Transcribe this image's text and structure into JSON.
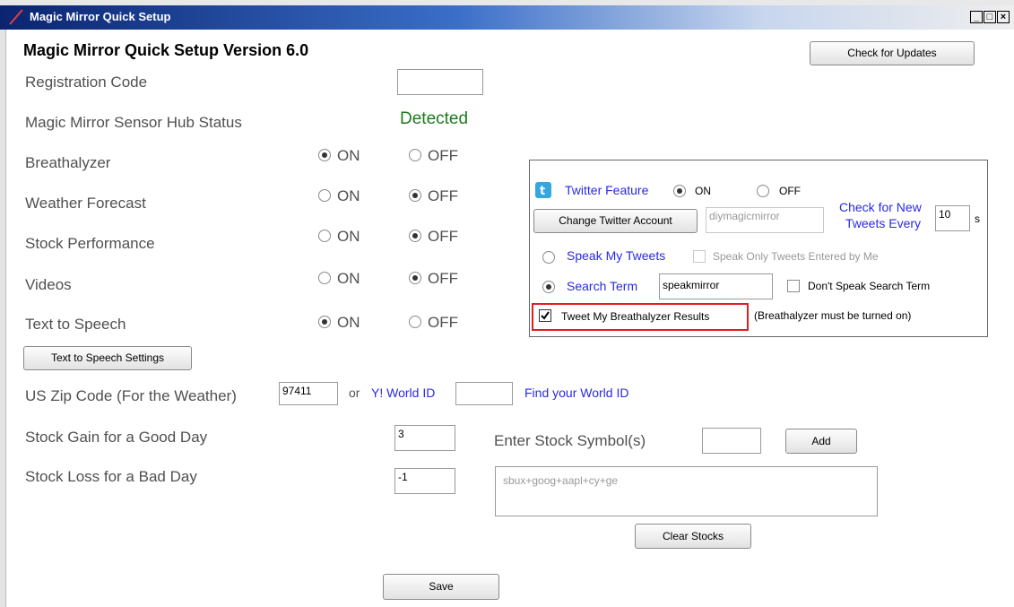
{
  "window": {
    "title": "Magic Mirror Quick Setup",
    "controls": [
      "_",
      "□",
      "×"
    ]
  },
  "app": {
    "heading": "Magic Mirror Quick Setup Version 6.0",
    "check_updates": "Check for Updates",
    "registration": {
      "label": "Registration Code",
      "value": ""
    },
    "hub": {
      "label": "Magic Mirror Sensor Hub Status",
      "status": "Detected",
      "status_color": "#1c7a1c"
    },
    "on_label": "ON",
    "off_label": "OFF",
    "features": [
      {
        "label": "Breathalyzer",
        "selected": "ON"
      },
      {
        "label": "Weather Forecast",
        "selected": "OFF"
      },
      {
        "label": "Stock Performance",
        "selected": "OFF"
      },
      {
        "label": "Videos",
        "selected": "OFF"
      },
      {
        "label": "Text to Speech",
        "selected": "ON"
      }
    ],
    "tts_settings": "Text to Speech Settings",
    "zip": {
      "label": "US Zip Code (For the Weather)",
      "value": "97411",
      "or": "or",
      "yworld_label": "Y! World ID",
      "yworld_value": "",
      "find_link": "Find your World ID"
    },
    "stock_gain": {
      "label": "Stock Gain for a Good Day",
      "value": "3"
    },
    "stock_loss": {
      "label": "Stock Loss for a Bad Day",
      "value": "-1"
    },
    "stock_symbol": {
      "label": "Enter Stock Symbol(s)",
      "value": "",
      "add": "Add"
    },
    "stocks_list": "sbux+goog+aapl+cy+ge",
    "clear_stocks": "Clear Stocks",
    "save": "Save"
  },
  "twitter": {
    "feature_label": "Twitter Feature",
    "on_label": "ON",
    "off_label": "OFF",
    "selected": "ON",
    "change_account": "Change Twitter Account",
    "account": "diymagicmirror",
    "check_new_line1": "Check for New",
    "check_new_line2": "Tweets Every",
    "interval": "10",
    "interval_unit": "s",
    "speak_tweets": "Speak My Tweets",
    "speak_only_mine": "Speak Only Tweets Entered by Me",
    "search_term_label": "Search Term",
    "search_term": "speakmirror",
    "dont_speak": "Don't Speak Search Term",
    "tweet_breath": "Tweet My Breathalyzer Results",
    "breath_note": "(Breathalyzer must be turned on)",
    "highlight_color": "#e02020"
  }
}
